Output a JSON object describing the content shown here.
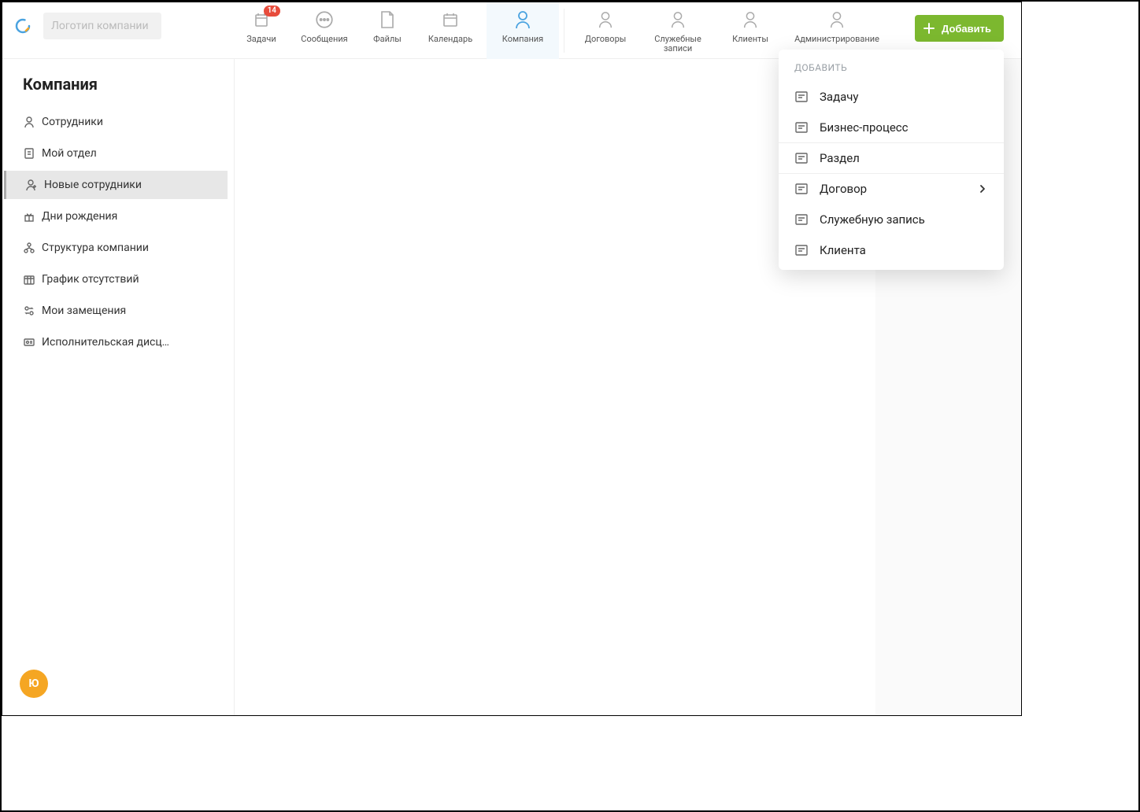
{
  "header": {
    "logo_placeholder": "Логотип компании",
    "add_button": "Добавить",
    "tabs": [
      {
        "label": "Задачи",
        "badge": "14"
      },
      {
        "label": "Сообщения"
      },
      {
        "label": "Файлы"
      },
      {
        "label": "Календарь"
      },
      {
        "label": "Компания",
        "active": true
      },
      {
        "label": "Договоры"
      },
      {
        "label": "Служебные\nзаписи"
      },
      {
        "label": "Клиенты"
      },
      {
        "label": "Администрирование"
      }
    ]
  },
  "sidebar": {
    "title": "Компания",
    "items": [
      {
        "label": "Сотрудники"
      },
      {
        "label": "Мой отдел"
      },
      {
        "label": "Новые сотрудники",
        "active": true
      },
      {
        "label": "Дни рождения"
      },
      {
        "label": "Структура компании"
      },
      {
        "label": "График отсутствий"
      },
      {
        "label": "Мои замещения"
      },
      {
        "label": "Исполнительская дисц…"
      }
    ]
  },
  "avatar_initial": "Ю",
  "dropdown": {
    "header": "ДОБАВИТЬ",
    "items": [
      {
        "label": "Задачу"
      },
      {
        "label": "Бизнес-процесс"
      },
      {
        "label": "Раздел",
        "sep": true
      },
      {
        "label": "Договор",
        "sep": true,
        "submenu": true
      },
      {
        "label": "Служебную запись"
      },
      {
        "label": "Клиента"
      }
    ]
  }
}
